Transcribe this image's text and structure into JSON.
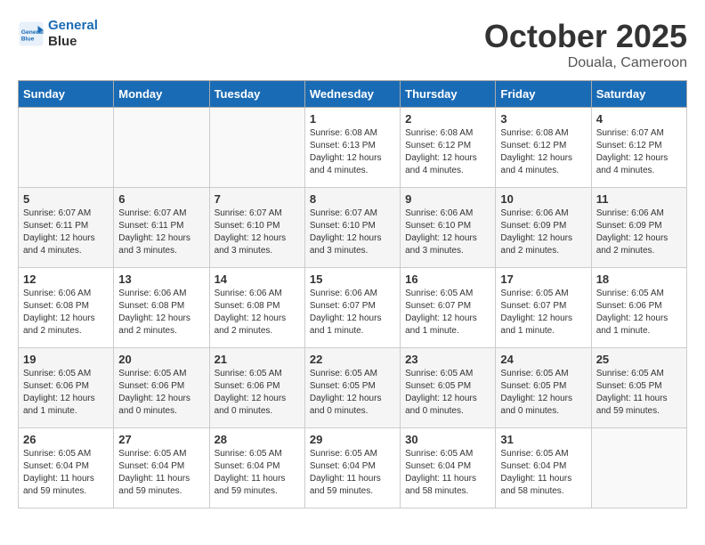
{
  "header": {
    "logo_line1": "General",
    "logo_line2": "Blue",
    "month": "October 2025",
    "location": "Douala, Cameroon"
  },
  "weekdays": [
    "Sunday",
    "Monday",
    "Tuesday",
    "Wednesday",
    "Thursday",
    "Friday",
    "Saturday"
  ],
  "weeks": [
    [
      {
        "day": "",
        "info": ""
      },
      {
        "day": "",
        "info": ""
      },
      {
        "day": "",
        "info": ""
      },
      {
        "day": "1",
        "info": "Sunrise: 6:08 AM\nSunset: 6:13 PM\nDaylight: 12 hours\nand 4 minutes."
      },
      {
        "day": "2",
        "info": "Sunrise: 6:08 AM\nSunset: 6:12 PM\nDaylight: 12 hours\nand 4 minutes."
      },
      {
        "day": "3",
        "info": "Sunrise: 6:08 AM\nSunset: 6:12 PM\nDaylight: 12 hours\nand 4 minutes."
      },
      {
        "day": "4",
        "info": "Sunrise: 6:07 AM\nSunset: 6:12 PM\nDaylight: 12 hours\nand 4 minutes."
      }
    ],
    [
      {
        "day": "5",
        "info": "Sunrise: 6:07 AM\nSunset: 6:11 PM\nDaylight: 12 hours\nand 4 minutes."
      },
      {
        "day": "6",
        "info": "Sunrise: 6:07 AM\nSunset: 6:11 PM\nDaylight: 12 hours\nand 3 minutes."
      },
      {
        "day": "7",
        "info": "Sunrise: 6:07 AM\nSunset: 6:10 PM\nDaylight: 12 hours\nand 3 minutes."
      },
      {
        "day": "8",
        "info": "Sunrise: 6:07 AM\nSunset: 6:10 PM\nDaylight: 12 hours\nand 3 minutes."
      },
      {
        "day": "9",
        "info": "Sunrise: 6:06 AM\nSunset: 6:10 PM\nDaylight: 12 hours\nand 3 minutes."
      },
      {
        "day": "10",
        "info": "Sunrise: 6:06 AM\nSunset: 6:09 PM\nDaylight: 12 hours\nand 2 minutes."
      },
      {
        "day": "11",
        "info": "Sunrise: 6:06 AM\nSunset: 6:09 PM\nDaylight: 12 hours\nand 2 minutes."
      }
    ],
    [
      {
        "day": "12",
        "info": "Sunrise: 6:06 AM\nSunset: 6:08 PM\nDaylight: 12 hours\nand 2 minutes."
      },
      {
        "day": "13",
        "info": "Sunrise: 6:06 AM\nSunset: 6:08 PM\nDaylight: 12 hours\nand 2 minutes."
      },
      {
        "day": "14",
        "info": "Sunrise: 6:06 AM\nSunset: 6:08 PM\nDaylight: 12 hours\nand 2 minutes."
      },
      {
        "day": "15",
        "info": "Sunrise: 6:06 AM\nSunset: 6:07 PM\nDaylight: 12 hours\nand 1 minute."
      },
      {
        "day": "16",
        "info": "Sunrise: 6:05 AM\nSunset: 6:07 PM\nDaylight: 12 hours\nand 1 minute."
      },
      {
        "day": "17",
        "info": "Sunrise: 6:05 AM\nSunset: 6:07 PM\nDaylight: 12 hours\nand 1 minute."
      },
      {
        "day": "18",
        "info": "Sunrise: 6:05 AM\nSunset: 6:06 PM\nDaylight: 12 hours\nand 1 minute."
      }
    ],
    [
      {
        "day": "19",
        "info": "Sunrise: 6:05 AM\nSunset: 6:06 PM\nDaylight: 12 hours\nand 1 minute."
      },
      {
        "day": "20",
        "info": "Sunrise: 6:05 AM\nSunset: 6:06 PM\nDaylight: 12 hours\nand 0 minutes."
      },
      {
        "day": "21",
        "info": "Sunrise: 6:05 AM\nSunset: 6:06 PM\nDaylight: 12 hours\nand 0 minutes."
      },
      {
        "day": "22",
        "info": "Sunrise: 6:05 AM\nSunset: 6:05 PM\nDaylight: 12 hours\nand 0 minutes."
      },
      {
        "day": "23",
        "info": "Sunrise: 6:05 AM\nSunset: 6:05 PM\nDaylight: 12 hours\nand 0 minutes."
      },
      {
        "day": "24",
        "info": "Sunrise: 6:05 AM\nSunset: 6:05 PM\nDaylight: 12 hours\nand 0 minutes."
      },
      {
        "day": "25",
        "info": "Sunrise: 6:05 AM\nSunset: 6:05 PM\nDaylight: 11 hours\nand 59 minutes."
      }
    ],
    [
      {
        "day": "26",
        "info": "Sunrise: 6:05 AM\nSunset: 6:04 PM\nDaylight: 11 hours\nand 59 minutes."
      },
      {
        "day": "27",
        "info": "Sunrise: 6:05 AM\nSunset: 6:04 PM\nDaylight: 11 hours\nand 59 minutes."
      },
      {
        "day": "28",
        "info": "Sunrise: 6:05 AM\nSunset: 6:04 PM\nDaylight: 11 hours\nand 59 minutes."
      },
      {
        "day": "29",
        "info": "Sunrise: 6:05 AM\nSunset: 6:04 PM\nDaylight: 11 hours\nand 59 minutes."
      },
      {
        "day": "30",
        "info": "Sunrise: 6:05 AM\nSunset: 6:04 PM\nDaylight: 11 hours\nand 58 minutes."
      },
      {
        "day": "31",
        "info": "Sunrise: 6:05 AM\nSunset: 6:04 PM\nDaylight: 11 hours\nand 58 minutes."
      },
      {
        "day": "",
        "info": ""
      }
    ]
  ]
}
